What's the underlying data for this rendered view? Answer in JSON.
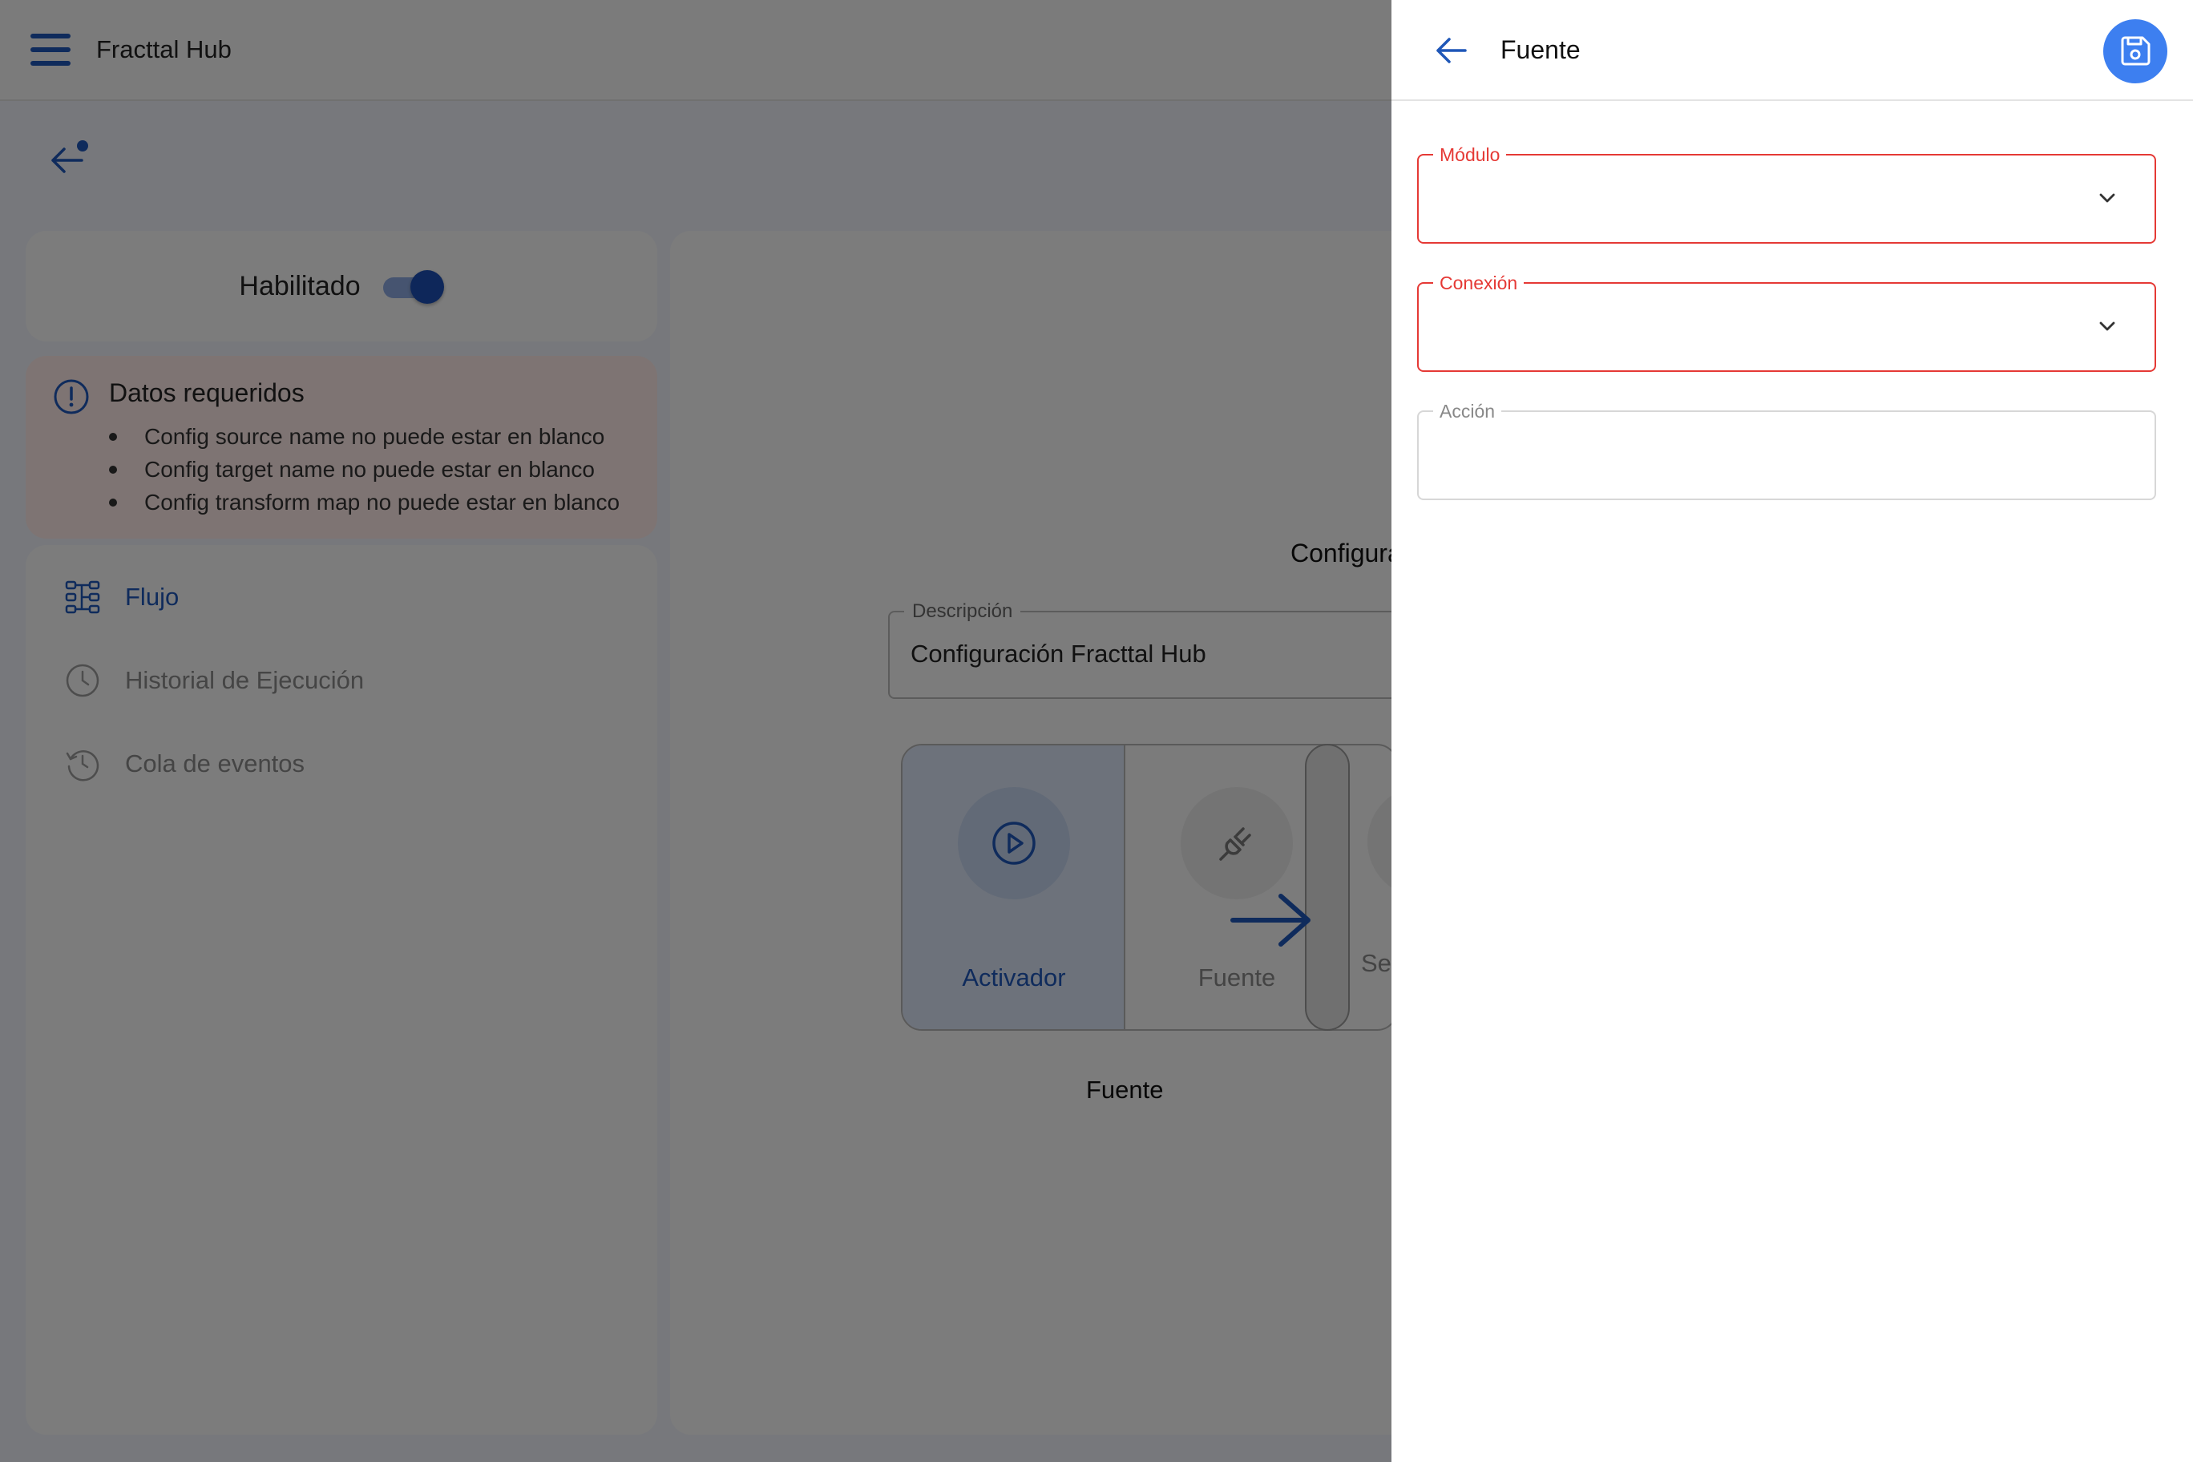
{
  "app": {
    "title": "Fracttal Hub"
  },
  "enabled": {
    "label": "Habilitado",
    "state": true
  },
  "required": {
    "title": "Datos requeridos",
    "items": [
      "Config source name no puede estar en blanco",
      "Config target name no puede estar en blanco",
      "Config transform map no puede estar en blanco"
    ]
  },
  "nav": {
    "items": [
      {
        "label": "Flujo",
        "icon": "flow-icon"
      },
      {
        "label": "Historial de Ejecución",
        "icon": "clock-icon"
      },
      {
        "label": "Cola de eventos",
        "icon": "history-icon"
      }
    ]
  },
  "main": {
    "config_title": "Configura",
    "description": {
      "label": "Descripción",
      "value": "Configuración Fracttal Hub"
    },
    "flow": {
      "steps": [
        {
          "label": "Activador",
          "icon": "play-icon"
        },
        {
          "label": "Fuente",
          "icon": "plug-icon"
        }
      ],
      "partial_label": "Se",
      "caption": "Fuente"
    }
  },
  "panel": {
    "title": "Fuente",
    "fields": {
      "module": {
        "label": "Módulo",
        "value": ""
      },
      "connection": {
        "label": "Conexión",
        "value": ""
      },
      "action": {
        "label": "Acción",
        "value": ""
      }
    }
  },
  "colors": {
    "accent": "#1f57b8",
    "save": "#3d7ff0",
    "error": "#e53935",
    "warning_bg": "#fde9e6"
  }
}
